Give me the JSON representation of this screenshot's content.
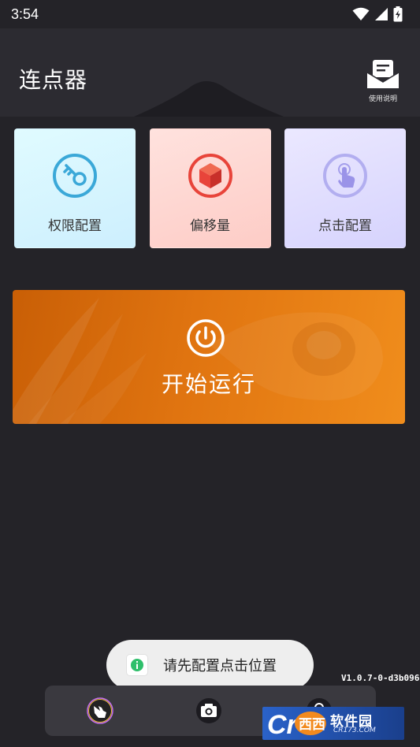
{
  "status_bar": {
    "time": "3:54",
    "icons": [
      "wifi-icon",
      "cellular-signal-icon",
      "battery-charging-icon"
    ]
  },
  "app_bar": {
    "title": "连点器",
    "help_label": "使用说明",
    "help_icon": "manual-icon"
  },
  "cards": [
    {
      "label": "权限配置",
      "icon": "key-icon",
      "color": "#3aa8d8"
    },
    {
      "label": "偏移量",
      "icon": "cube-icon",
      "color": "#e8443a"
    },
    {
      "label": "点击配置",
      "icon": "tap-icon",
      "color": "#9a93e8"
    }
  ],
  "start": {
    "label": "开始运行",
    "icon": "power-icon",
    "color": "#e07410"
  },
  "toast": {
    "text": "请先配置点击位置",
    "icon": "app-icon"
  },
  "version": "V1.0.7-0-d3b096",
  "bottom_nav": [
    "hand-pointer-icon",
    "camera-icon",
    "person-icon"
  ],
  "watermark": {
    "brand": "软件园",
    "sub": "CR173.COM"
  }
}
